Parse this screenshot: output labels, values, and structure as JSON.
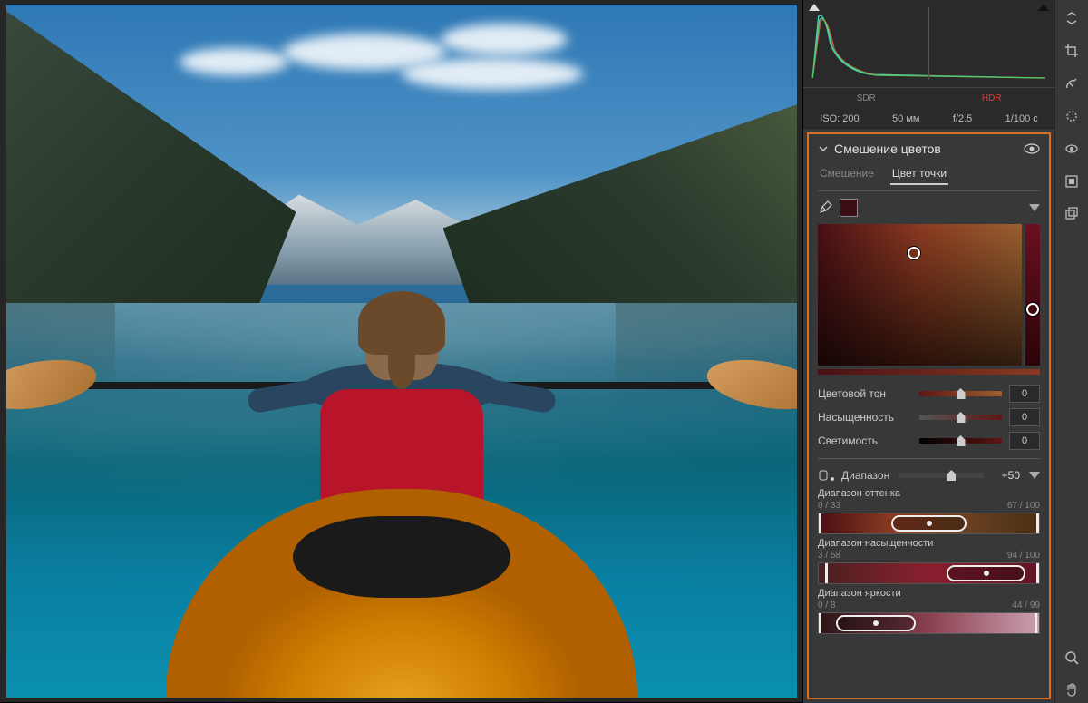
{
  "exif": {
    "iso": "ISO: 200",
    "focal": "50 мм",
    "aperture": "f/2.5",
    "shutter": "1/100 с"
  },
  "histogram_tabs": {
    "sdr": "SDR",
    "hdr": "HDR"
  },
  "panel": {
    "title": "Смешение цветов",
    "tabs": {
      "mixing": "Смешение",
      "point": "Цвет точки"
    },
    "sliders": {
      "hue": {
        "label": "Цветовой тон",
        "value": "0"
      },
      "sat": {
        "label": "Насыщенность",
        "value": "0"
      },
      "lum": {
        "label": "Светимость",
        "value": "0"
      }
    },
    "range": {
      "label": "Диапазон",
      "value": "+50",
      "hue_range": {
        "title": "Диапазон оттенка",
        "left": "0 / 33",
        "right": "67 / 100"
      },
      "sat_range": {
        "title": "Диапазон насыщенности",
        "left": "3 / 58",
        "right": "94 / 100"
      },
      "lum_range": {
        "title": "Диапазон яркости",
        "left": "0 / 8",
        "right": "44 / 99"
      }
    }
  }
}
